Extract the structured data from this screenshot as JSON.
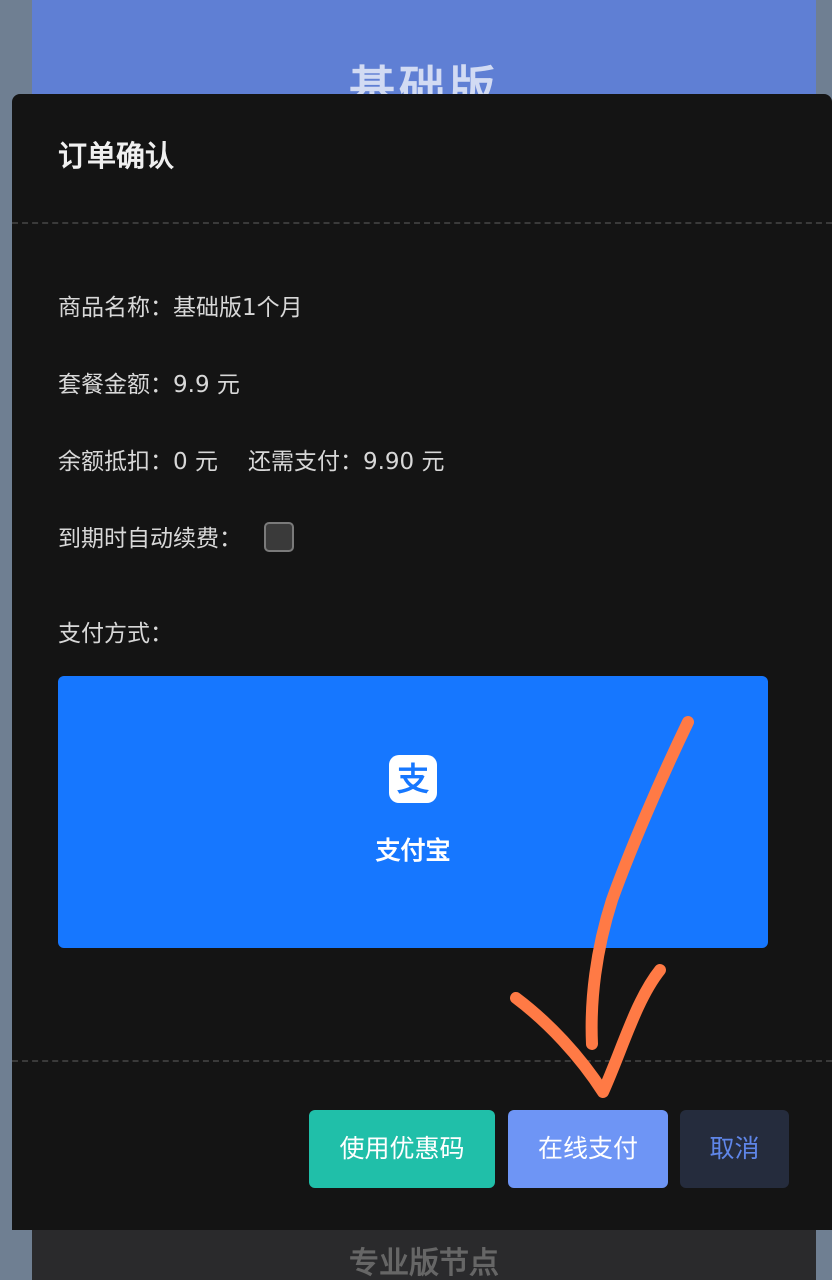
{
  "background": {
    "top_plan_title": "基础版",
    "bottom_plan_title": "专业版节点"
  },
  "modal": {
    "title": "订单确认",
    "product_label": "商品名称：",
    "product_value": "基础版1个月",
    "price_label": "套餐金额：",
    "price_value": "9.9 元",
    "balance_label": "余额抵扣：",
    "balance_value": "0 元",
    "due_label": "还需支付：",
    "due_value": "9.90 元",
    "auto_renew_label": "到期时自动续费：",
    "auto_renew_checked": false,
    "payment_method_label": "支付方式：",
    "payment_option": {
      "label": "支付宝",
      "icon": "alipay-icon",
      "logo_glyph": "支"
    }
  },
  "buttons": {
    "coupon": "使用优惠码",
    "online_pay": "在线支付",
    "cancel": "取消"
  },
  "colors": {
    "modal_bg": "#141414",
    "alipay_blue": "#1677ff",
    "coupon_teal": "#20bfa9",
    "pay_blue": "#6e95f5",
    "cancel_bg": "#252c3d",
    "annotation_orange": "#ff7a45"
  }
}
